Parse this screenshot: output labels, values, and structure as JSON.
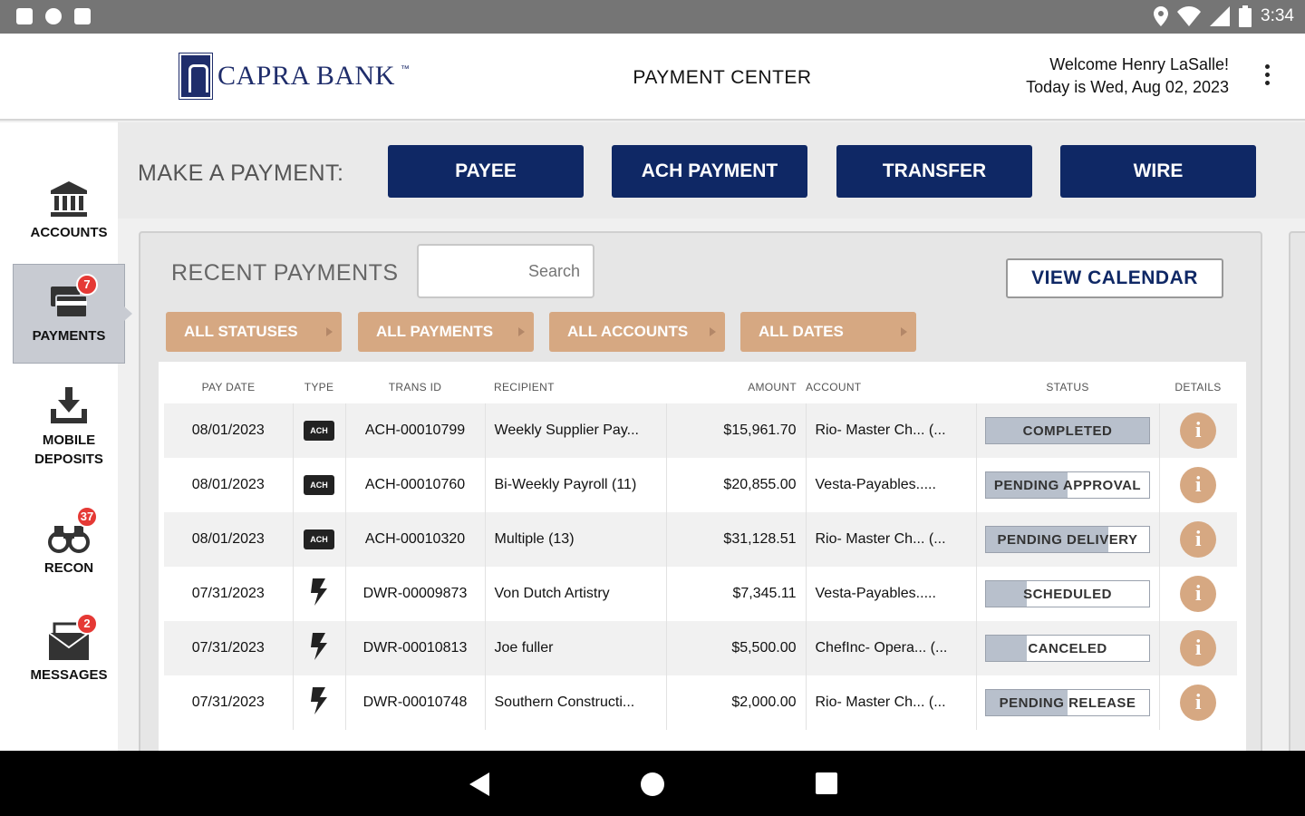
{
  "statusbar": {
    "time": "3:34"
  },
  "header": {
    "bank_name": "CAPRA BANK",
    "tm": "™",
    "title": "PAYMENT CENTER",
    "welcome": "Welcome Henry LaSalle!",
    "date": "Today is Wed, Aug 02, 2023"
  },
  "sidebar": {
    "items": [
      {
        "label": "ACCOUNTS",
        "badge": ""
      },
      {
        "label": "PAYMENTS",
        "badge": "7"
      },
      {
        "label": "MOBILE",
        "label2": "DEPOSITS",
        "badge": ""
      },
      {
        "label": "RECON",
        "badge": "37"
      },
      {
        "label": "MESSAGES",
        "badge": "2"
      }
    ]
  },
  "paybar": {
    "label": "MAKE A PAYMENT:",
    "buttons": [
      "PAYEE",
      "ACH PAYMENT",
      "TRANSFER",
      "WIRE"
    ]
  },
  "recent": {
    "title": "RECENT PAYMENTS",
    "search_placeholder": "Search",
    "view_calendar": "VIEW CALENDAR",
    "filters": [
      "ALL STATUSES",
      "ALL PAYMENTS",
      "ALL ACCOUNTS",
      "ALL DATES"
    ],
    "columns": [
      "PAY DATE",
      "TYPE",
      "TRANS ID",
      "RECIPIENT",
      "AMOUNT",
      "ACCOUNT",
      "STATUS",
      "DETAILS"
    ],
    "rows": [
      {
        "date": "08/01/2023",
        "type": "ach",
        "type_label": "ACH",
        "tid": "ACH-00010799",
        "recipient": "Weekly Supplier Pay...",
        "amount": "$15,961.70",
        "account": "Rio- Master Ch... (...",
        "status": "COMPLETED",
        "progress": 1.0
      },
      {
        "date": "08/01/2023",
        "type": "ach",
        "type_label": "ACH",
        "tid": "ACH-00010760",
        "recipient": "Bi-Weekly Payroll (11)",
        "amount": "$20,855.00",
        "account": "Vesta-Payables.....",
        "status": "PENDING APPROVAL",
        "progress": 0.5
      },
      {
        "date": "08/01/2023",
        "type": "ach",
        "type_label": "ACH",
        "tid": "ACH-00010320",
        "recipient": "Multiple (13)",
        "amount": "$31,128.51",
        "account": "Rio- Master Ch... (...",
        "status": "PENDING DELIVERY",
        "progress": 0.75
      },
      {
        "date": "07/31/2023",
        "type": "wire",
        "type_label": "",
        "tid": "DWR-00009873",
        "recipient": "Von Dutch Artistry",
        "amount": "$7,345.11",
        "account": "Vesta-Payables.....",
        "status": "SCHEDULED",
        "progress": 0.25
      },
      {
        "date": "07/31/2023",
        "type": "wire",
        "type_label": "",
        "tid": "DWR-00010813",
        "recipient": "Joe fuller",
        "amount": "$5,500.00",
        "account": "ChefInc- Opera... (...",
        "status": "CANCELED",
        "progress": 0.25
      },
      {
        "date": "07/31/2023",
        "type": "wire",
        "type_label": "",
        "tid": "DWR-00010748",
        "recipient": "Southern Constructi...",
        "amount": "$2,000.00",
        "account": "Rio- Master Ch... (...",
        "status": "PENDING RELEASE",
        "progress": 0.5
      }
    ],
    "info_glyph": "i"
  },
  "colors": {
    "navy": "#0f2865",
    "tan": "#d6a882",
    "badge_red": "#e53935"
  }
}
